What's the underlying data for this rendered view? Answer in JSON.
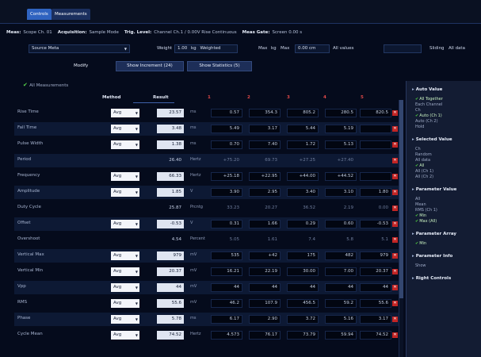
{
  "tabs": [
    {
      "label": "Controls"
    },
    {
      "label": "Measurements"
    }
  ],
  "infobar": [
    {
      "key": "Meas:",
      "value": "Scope Ch. 01"
    },
    {
      "key": "Acquisition:",
      "value": "Sample Mode"
    },
    {
      "key": "Trig. Level:",
      "value": "Channel Ch.1 / 0.00V Rise Continuous"
    },
    {
      "key": "Meas Gate:",
      "value": "Screen 0.00 s"
    }
  ],
  "controls": {
    "source_value": "Source Meta",
    "weight_label": "Weight",
    "weight_value": "1.00",
    "weight_unit": "kg",
    "weight_mode": "Weighted",
    "max_label": "Max",
    "max_unit": "kg",
    "max_mode": "Max",
    "count_value": "0.00 cm",
    "count_mode": "All values",
    "window_label": "Sliding",
    "window_value": "All data"
  },
  "buttons": {
    "modify": "Modify",
    "show_increment": "Show Increment (24)",
    "show_statistics": "Show Statistics (5)"
  },
  "enable_label": "All Measurements",
  "table": {
    "headers": {
      "method": "Method",
      "result": "Result",
      "c1": "1",
      "c2": "2",
      "c3": "3",
      "c4": "4",
      "c5": "5"
    },
    "rows": [
      {
        "name": "Rise Time",
        "method": "Avg",
        "result": "23.57",
        "unit": "ms",
        "v": [
          "0.57",
          "354.3",
          "805.2",
          "280.5",
          "820.5"
        ]
      },
      {
        "name": "Fall Time",
        "method": "Avg",
        "result": "3.48",
        "unit": "ms",
        "v": [
          "5.49",
          "3.17",
          "5.44",
          "5.19",
          ""
        ]
      },
      {
        "name": "Pulse Width",
        "method": "Avg",
        "result": "1.38",
        "unit": "ms",
        "v": [
          "0.70",
          "7.40",
          "1.72",
          "5.13",
          ""
        ]
      },
      {
        "name": "Period",
        "method": "",
        "result": "26.40",
        "unit": "Hertz",
        "v": [
          "+75.20",
          "69.73",
          "+27.25",
          "+27.40",
          ""
        ]
      },
      {
        "name": "Frequency",
        "method": "Avg",
        "result": "66.33",
        "unit": "Hertz",
        "v": [
          "+25.18",
          "+22.95",
          "+44.00",
          "+44.52",
          ""
        ]
      },
      {
        "name": "Amplitude",
        "method": "Avg",
        "result": "1.85",
        "unit": "V",
        "v": [
          "3.90",
          "2.95",
          "3.40",
          "3.10",
          "1.80"
        ]
      },
      {
        "name": "Duty Cycle",
        "method": "",
        "result": "25.87",
        "unit": "Prcntg",
        "v": [
          "33.23",
          "20.27",
          "36.52",
          "2.19",
          "0.00"
        ]
      },
      {
        "name": "Offset",
        "method": "Avg",
        "result": "-0.53",
        "unit": "V",
        "v": [
          "0.31",
          "1.66",
          "0.29",
          "0.60",
          "-0.53"
        ]
      },
      {
        "name": "Overshoot",
        "method": "",
        "result": "4.54",
        "unit": "Percent",
        "v": [
          "5.05",
          "1.61",
          "7.4",
          "5.8",
          "5.1"
        ]
      },
      {
        "name": "Vertical Max",
        "method": "Avg",
        "result": "979",
        "unit": "mV",
        "v": [
          "535",
          "+42",
          "175",
          "482",
          "979"
        ]
      },
      {
        "name": "Vertical Min",
        "method": "Avg",
        "result": "20.37",
        "unit": "mV",
        "v": [
          "16.21",
          "22.19",
          "30.00",
          "7.00",
          "20.37"
        ]
      },
      {
        "name": "Vpp",
        "method": "Avg",
        "result": "44",
        "unit": "mV",
        "v": [
          "44",
          "44",
          "44",
          "44",
          "44"
        ]
      },
      {
        "name": "RMS",
        "method": "Avg",
        "result": "55.6",
        "unit": "mV",
        "v": [
          "46.2",
          "107.9",
          "456.5",
          "59.2",
          "55.6"
        ]
      },
      {
        "name": "Phase",
        "method": "Avg",
        "result": "5.78",
        "unit": "ms",
        "v": [
          "6.17",
          "2.90",
          "3.72",
          "5.16",
          "3.17"
        ]
      },
      {
        "name": "Cycle Mean",
        "method": "Avg",
        "result": "74.52",
        "unit": "Hertz",
        "v": [
          "4.573",
          "76.17",
          "73.79",
          "59.94",
          "74.52"
        ]
      }
    ]
  },
  "panel": {
    "sections": [
      {
        "label": "Auto Value",
        "options": [
          {
            "label": "All Together",
            "on": true
          },
          {
            "label": "Each Channel",
            "on": false
          },
          {
            "label": "Ch",
            "on": false
          },
          {
            "label": "Auto (Ch 1)",
            "on": true
          },
          {
            "label": "Auto (Ch 2)",
            "on": false
          },
          {
            "label": "Hold",
            "on": false
          }
        ]
      },
      {
        "label": "Selected Value",
        "options": [
          {
            "label": "Ch",
            "on": false
          },
          {
            "label": "Random",
            "on": false
          },
          {
            "label": "All data",
            "on": false
          },
          {
            "label": "All",
            "on": true
          },
          {
            "label": "All (Ch 1)",
            "on": false
          },
          {
            "label": "All (Ch 2)",
            "on": false
          }
        ]
      },
      {
        "label": "Parameter Value",
        "options": [
          {
            "label": "All",
            "on": false
          },
          {
            "label": "Mean",
            "on": false
          },
          {
            "label": "RMS (Ch 1)",
            "on": false
          },
          {
            "label": "Min",
            "on": true
          },
          {
            "label": "Max (All)",
            "on": true
          }
        ]
      },
      {
        "label": "Parameter Array",
        "options": [
          {
            "label": "Min",
            "on": true
          }
        ]
      },
      {
        "label": "Parameter Info",
        "options": [
          {
            "label": "Show",
            "on": false
          }
        ]
      },
      {
        "label": "Right Controls",
        "options": []
      }
    ]
  }
}
